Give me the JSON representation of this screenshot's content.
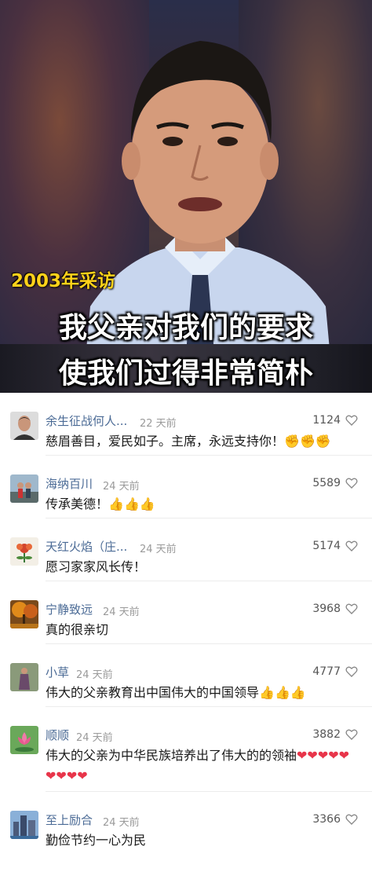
{
  "video": {
    "year_label": "2003年采访",
    "subtitle_line1": "我父亲对我们的要求",
    "subtitle_line2": "使我们过得非常简朴"
  },
  "comments": [
    {
      "name": "余生征战何人...",
      "time": "22 天前",
      "likes": "1124",
      "text": "慈眉善目，爱民如子。主席，永远支持你！",
      "emoji": "✊✊✊",
      "avatar_icon": "man-portrait-avatar"
    },
    {
      "name": "海纳百川",
      "time": "24 天前",
      "likes": "5589",
      "text": "传承美德！",
      "emoji": "👍👍👍",
      "avatar_icon": "couple-photo-avatar"
    },
    {
      "name": "天红火焰（庄...",
      "time": "24 天前",
      "likes": "5174",
      "text": "愿习家家风长传！",
      "emoji": "",
      "avatar_icon": "flower-avatar"
    },
    {
      "name": "宁静致远",
      "time": "24 天前",
      "likes": "3968",
      "text": "真的很亲切",
      "emoji": "",
      "avatar_icon": "autumn-tree-avatar"
    },
    {
      "name": "小草",
      "time": "24 天前",
      "likes": "4777",
      "text": "伟大的父亲教育出中国伟大的中国领导",
      "emoji": "👍👍👍",
      "avatar_icon": "woman-standing-avatar"
    },
    {
      "name": "顺顺",
      "time": "24 天前",
      "likes": "3882",
      "text": "伟大的父亲为中华民族培养出了伟大的的领袖",
      "emoji": "❤❤❤❤❤❤❤❤❤",
      "avatar_icon": "lotus-avatar"
    },
    {
      "name": "至上励合",
      "time": "24 天前",
      "likes": "3366",
      "text": "勤俭节约一心为民",
      "emoji": "",
      "avatar_icon": "city-skyline-avatar"
    }
  ],
  "colors": {
    "name_blue": "#4a6a95",
    "time_gray": "#9a9a9a",
    "year_yellow": "#ffd21a",
    "heart_red": "#e8354a"
  }
}
